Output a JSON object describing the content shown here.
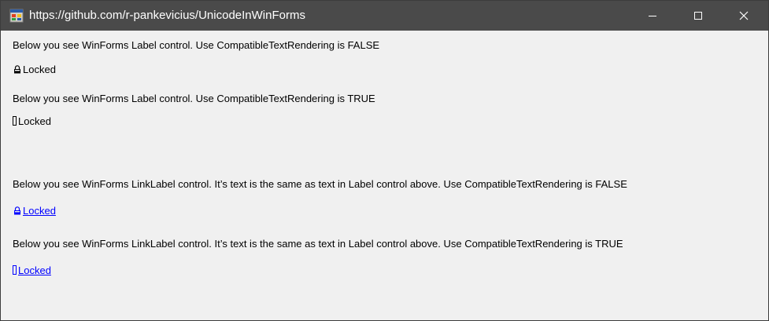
{
  "window": {
    "title": "https://github.com/r-pankevicius/UnicodeInWinForms"
  },
  "controls": [
    {
      "caption": "Below you see WinForms Label control. Use CompatibleTextRendering is FALSE",
      "value_label": "Locked",
      "kind": "label",
      "glyph": "lock-icon"
    },
    {
      "caption": "Below you see WinForms Label control. Use CompatibleTextRendering is TRUE",
      "value_label": "Locked",
      "kind": "label",
      "glyph": "missing-glyph-box"
    },
    {
      "caption": "Below you see WinForms LinkLabel control. It’s text is the same as text in Label control above. Use CompatibleTextRendering is FALSE",
      "value_label": "Locked",
      "kind": "linklabel",
      "glyph": "lock-icon"
    },
    {
      "caption": "Below you see WinForms LinkLabel control. It’s text is the same as text in Label control above. Use CompatibleTextRendering is TRUE",
      "value_label": "Locked",
      "kind": "linklabel",
      "glyph": "missing-glyph-box"
    }
  ],
  "colors": {
    "titlebar": "#4a4a4a",
    "client_area": "#f0f0f0",
    "link": "#0000ff"
  }
}
